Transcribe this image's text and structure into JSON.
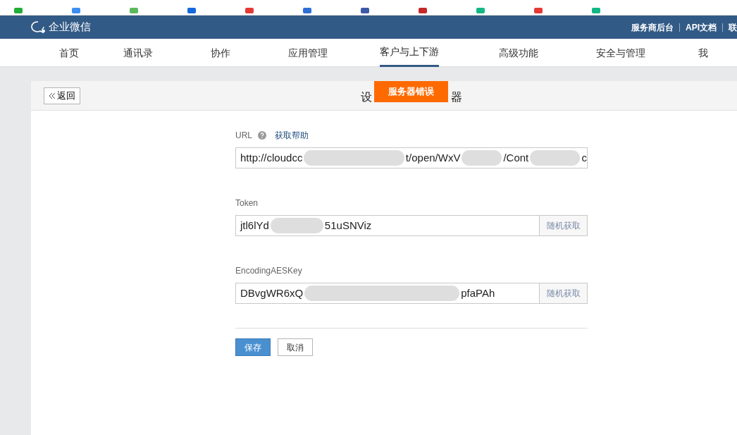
{
  "header": {
    "logo": "企业微信",
    "links": [
      "服务商后台",
      "API文档",
      "联"
    ]
  },
  "nav": [
    {
      "label": "首页",
      "selected": false
    },
    {
      "label": "通讯录",
      "selected": false
    },
    {
      "label": "协作",
      "selected": false
    },
    {
      "label": "应用管理",
      "selected": false
    },
    {
      "label": "客户与上下游",
      "selected": true
    },
    {
      "label": "高级功能",
      "selected": false
    },
    {
      "label": "安全与管理",
      "selected": false
    },
    {
      "label": "我",
      "selected": false
    }
  ],
  "panel": {
    "back_button": "返回",
    "title_start": "设",
    "title_end": "器",
    "toast": "服务器错误"
  },
  "form": {
    "help_link": "获取帮助",
    "fields": [
      {
        "label": "URL",
        "help": true,
        "segments": [
          {
            "kind": "text",
            "text": "http://cloudcc"
          },
          {
            "kind": "blur"
          },
          {
            "kind": "text",
            "text": "t/open/WxV"
          },
          {
            "kind": "blur"
          },
          {
            "kind": "text",
            "text": "/Cont"
          },
          {
            "kind": "blur"
          },
          {
            "kind": "text",
            "text": "c"
          }
        ]
      },
      {
        "label": "Token",
        "help": false,
        "button": "随机获取",
        "segments": [
          {
            "kind": "text",
            "text": "jtl6lYd"
          },
          {
            "kind": "blur"
          },
          {
            "kind": "text",
            "text": "51uSNViz"
          }
        ]
      },
      {
        "label": "EncodingAESKey",
        "help": false,
        "button": "随机获取",
        "segments": [
          {
            "kind": "text",
            "text": "DBvgWR6xQ"
          },
          {
            "kind": "blur"
          },
          {
            "kind": "text",
            "text": "pfaPAh"
          }
        ]
      }
    ],
    "save": "保存",
    "cancel": "取消"
  }
}
